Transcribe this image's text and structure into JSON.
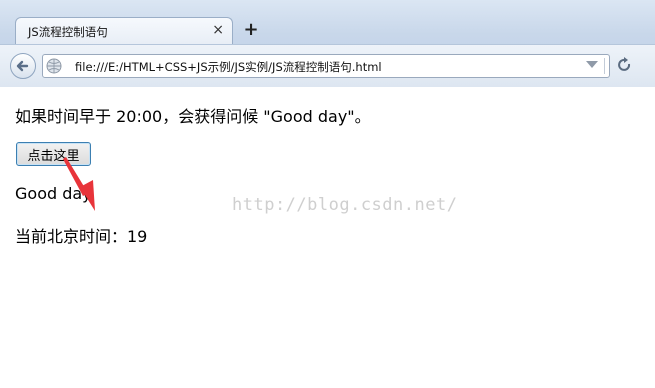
{
  "browser": {
    "tab_title": "JS流程控制语句",
    "tab_close": "×",
    "new_tab": "+",
    "url": "file:///E:/HTML+CSS+JS示例/JS实例/JS流程控制语句.html"
  },
  "page": {
    "intro": "如果时间早于 20:00，会获得问候 \"Good day\"。",
    "button_label": "点击这里",
    "greeting": "Good day",
    "time_line": "当前北京时间：19"
  },
  "watermark": "http://blog.csdn.net/",
  "annotation": {
    "arrow_color": "#e8343a"
  }
}
